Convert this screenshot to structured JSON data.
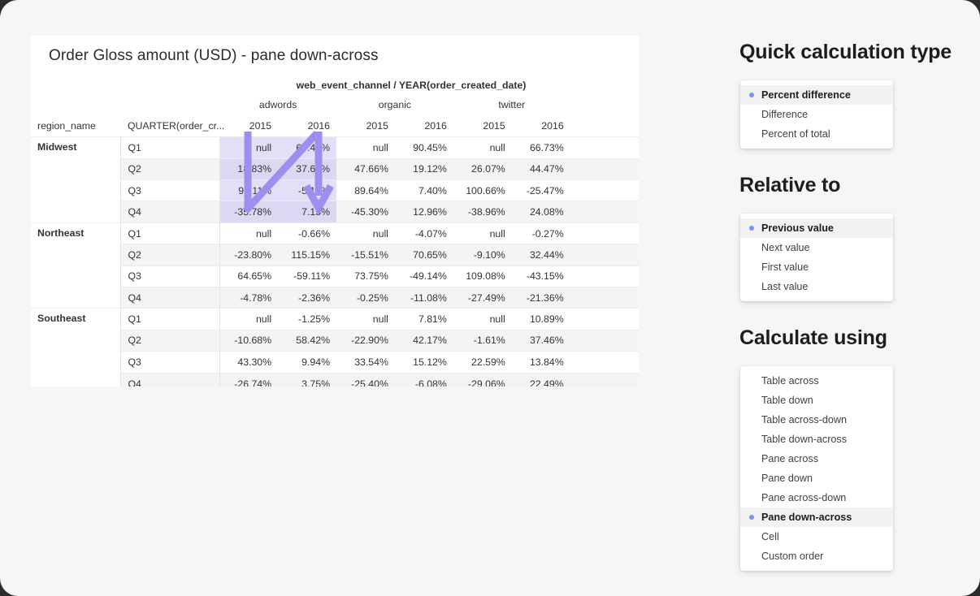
{
  "viz": {
    "title": "Order Gloss amount (USD) - pane down-across",
    "column_field_label": "web_event_channel / YEAR(order_created_date)",
    "row_header_region": "region_name",
    "row_header_quarter": "QUARTER(order_cr...",
    "channels": [
      "adwords",
      "organic",
      "twitter"
    ],
    "years": [
      "2015",
      "2016"
    ],
    "highlight_color": "#e4dff6",
    "arrow_color": "#9f8df0",
    "rows": [
      {
        "region": "Midwest",
        "quarter": "Q1",
        "values": [
          "null",
          "67.44%",
          "null",
          "90.45%",
          "null",
          "66.73%"
        ]
      },
      {
        "region": "Midwest",
        "quarter": "Q2",
        "values": [
          "18.83%",
          "37.67%",
          "47.66%",
          "19.12%",
          "26.07%",
          "44.47%"
        ]
      },
      {
        "region": "Midwest",
        "quarter": "Q3",
        "values": [
          "95.11%",
          "-5.12%",
          "89.64%",
          "7.40%",
          "100.66%",
          "-25.47%"
        ]
      },
      {
        "region": "Midwest",
        "quarter": "Q4",
        "values": [
          "-35.78%",
          "7.15%",
          "-45.30%",
          "12.96%",
          "-38.96%",
          "24.08%"
        ]
      },
      {
        "region": "Northeast",
        "quarter": "Q1",
        "values": [
          "null",
          "-0.66%",
          "null",
          "-4.07%",
          "null",
          "-0.27%"
        ]
      },
      {
        "region": "Northeast",
        "quarter": "Q2",
        "values": [
          "-23.80%",
          "115.15%",
          "-15.51%",
          "70.65%",
          "-9.10%",
          "32.44%"
        ]
      },
      {
        "region": "Northeast",
        "quarter": "Q3",
        "values": [
          "64.65%",
          "-59.11%",
          "73.75%",
          "-49.14%",
          "109.08%",
          "-43.15%"
        ]
      },
      {
        "region": "Northeast",
        "quarter": "Q4",
        "values": [
          "-4.78%",
          "-2.36%",
          "-0.25%",
          "-11.08%",
          "-27.49%",
          "-21.36%"
        ]
      },
      {
        "region": "Southeast",
        "quarter": "Q1",
        "values": [
          "null",
          "-1.25%",
          "null",
          "7.81%",
          "null",
          "10.89%"
        ]
      },
      {
        "region": "Southeast",
        "quarter": "Q2",
        "values": [
          "-10.68%",
          "58.42%",
          "-22.90%",
          "42.17%",
          "-1.61%",
          "37.46%"
        ]
      },
      {
        "region": "Southeast",
        "quarter": "Q3",
        "values": [
          "43.30%",
          "9.94%",
          "33.54%",
          "15.12%",
          "22.59%",
          "13.84%"
        ]
      },
      {
        "region": "Southeast",
        "quarter": "Q4",
        "values": [
          "-26.74%",
          "3.75%",
          "-25.40%",
          "-6.08%",
          "-29.06%",
          "22.49%"
        ]
      }
    ]
  },
  "panels": {
    "quick_calculation_type": {
      "heading": "Quick calculation type",
      "items": [
        {
          "label": "Percent difference",
          "selected": true
        },
        {
          "label": "Difference",
          "selected": false
        },
        {
          "label": "Percent of total",
          "selected": false
        }
      ]
    },
    "relative_to": {
      "heading": "Relative to",
      "items": [
        {
          "label": "Previous value",
          "selected": true
        },
        {
          "label": "Next value",
          "selected": false
        },
        {
          "label": "First value",
          "selected": false
        },
        {
          "label": "Last value",
          "selected": false
        }
      ]
    },
    "calculate_using": {
      "heading": "Calculate using",
      "items": [
        {
          "label": "Table across",
          "selected": false
        },
        {
          "label": "Table down",
          "selected": false
        },
        {
          "label": "Table across-down",
          "selected": false
        },
        {
          "label": "Table down-across",
          "selected": false
        },
        {
          "label": "Pane across",
          "selected": false
        },
        {
          "label": "Pane down",
          "selected": false
        },
        {
          "label": "Pane across-down",
          "selected": false
        },
        {
          "label": "Pane down-across",
          "selected": true
        },
        {
          "label": "Cell",
          "selected": false
        },
        {
          "label": "Custom order",
          "selected": false
        }
      ]
    }
  }
}
